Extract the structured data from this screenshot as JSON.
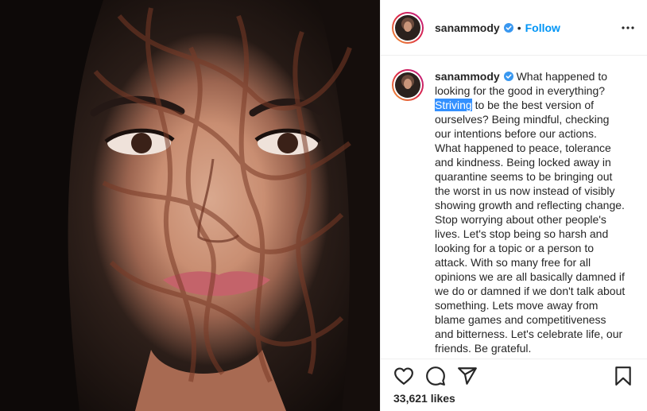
{
  "post": {
    "username": "sanammody",
    "follow_label": "Follow",
    "separator": "•",
    "caption": {
      "username": "sanammody",
      "text_before": "What happened to looking for the good in everything? ",
      "highlight": "Striving",
      "text_after": " to be the best version of ourselves? Being mindful, checking our intentions before our actions. What happened to peace, tolerance and kindness. Being locked away in quarantine seems to be bringing out the worst in us now instead of visibly showing growth and reflecting change. Stop worrying about other people's lives. Let's stop being so harsh and looking for a topic or a person to attack. With so many free for all opinions we are all basically damned if we do or damned if we don't talk about something. Lets move away from blame games and competitiveness and bitterness. Let's celebrate life, our friends. Be grateful."
    },
    "likes": "33,621 likes"
  },
  "colors": {
    "accent": "#0095f6",
    "verified": "#3897f0",
    "selection": "#3390ff",
    "text": "#262626",
    "border": "#efefef"
  },
  "icons": {
    "verified": "verified-badge-icon",
    "more": "more-options-icon",
    "like": "heart-icon",
    "comment": "comment-icon",
    "share": "paper-plane-icon",
    "save": "bookmark-icon"
  }
}
